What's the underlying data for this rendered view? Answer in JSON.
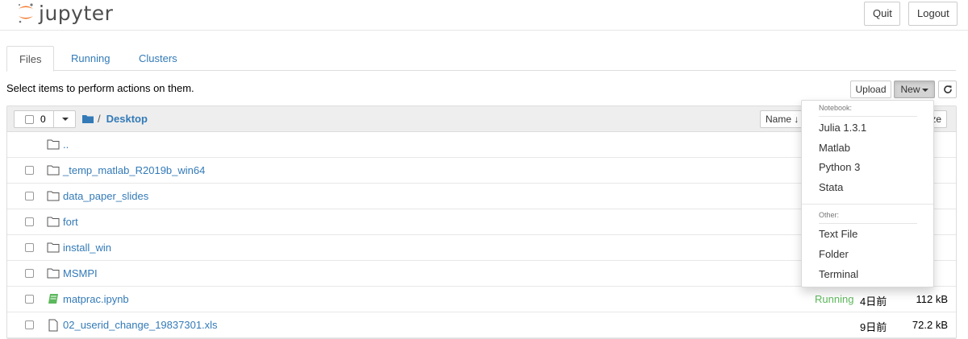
{
  "header": {
    "logo_text": "jupyter",
    "quit_label": "Quit",
    "logout_label": "Logout"
  },
  "tabs": [
    {
      "label": "Files",
      "active": true
    },
    {
      "label": "Running",
      "active": false
    },
    {
      "label": "Clusters",
      "active": false
    }
  ],
  "toolbar": {
    "instructions": "Select items to perform actions on them.",
    "upload_label": "Upload",
    "new_label": "New",
    "refresh_icon": "refresh-icon"
  },
  "list_header": {
    "selected_count": "0",
    "breadcrumb_sep": "/",
    "breadcrumb_current": "Desktop",
    "sort_name_label": "Name",
    "sort_size_label": "ze"
  },
  "rows": [
    {
      "name": "..",
      "type": "parent",
      "status": "",
      "date": "",
      "size": ""
    },
    {
      "name": "_temp_matlab_R2019b_win64",
      "type": "folder",
      "status": "",
      "date": "",
      "size": ""
    },
    {
      "name": "data_paper_slides",
      "type": "folder",
      "status": "",
      "date": "",
      "size": ""
    },
    {
      "name": "fort",
      "type": "folder",
      "status": "",
      "date": "",
      "size": ""
    },
    {
      "name": "install_win",
      "type": "folder",
      "status": "",
      "date": "",
      "size": ""
    },
    {
      "name": "MSMPI",
      "type": "folder",
      "status": "",
      "date": "",
      "size": ""
    },
    {
      "name": "matprac.ipynb",
      "type": "notebook",
      "status": "Running",
      "date": "4日前",
      "size": "112 kB"
    },
    {
      "name": "02_userid_change_19837301.xls",
      "type": "file",
      "status": "",
      "date": "9日前",
      "size": "72.2 kB"
    }
  ],
  "new_menu": {
    "notebook_header": "Notebook:",
    "notebook_items": [
      "Julia 1.3.1",
      "Matlab",
      "Python 3",
      "Stata"
    ],
    "other_header": "Other:",
    "other_items": [
      "Text File",
      "Folder",
      "Terminal"
    ]
  },
  "colors": {
    "link": "#337ab7",
    "running": "#5cb85c",
    "logo_orange": "#f37626"
  }
}
